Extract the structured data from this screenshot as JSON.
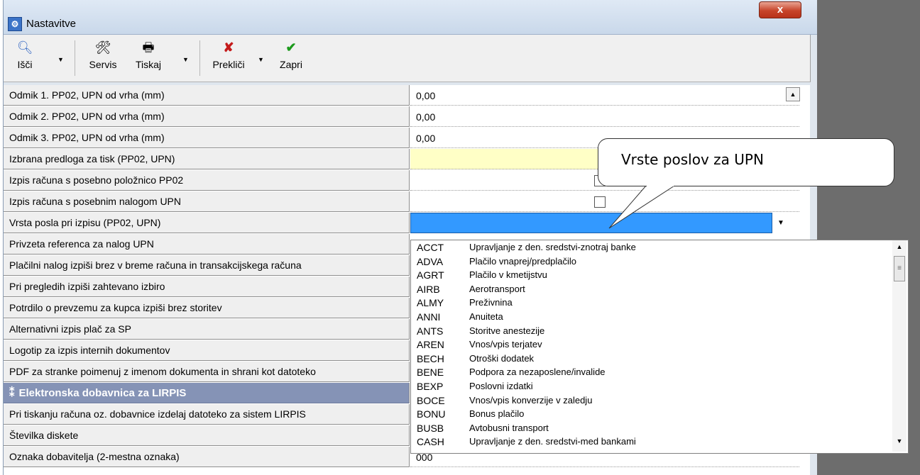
{
  "window": {
    "title": "Nastavitve",
    "close_label": "x"
  },
  "toolbar": {
    "search_label": "Išči",
    "service_label": "Servis",
    "print_label": "Tiskaj",
    "cancel_label": "Prekliči",
    "close_label": "Zapri"
  },
  "rows": [
    {
      "label": "Odmik 1. PP02, UPN od vrha (mm)",
      "value": "0,00"
    },
    {
      "label": "Odmik 2. PP02, UPN od vrha (mm)",
      "value": "0,00"
    },
    {
      "label": "Odmik 3. PP02, UPN od vrha (mm)",
      "value": "0,00"
    },
    {
      "label": "Izbrana predloga za tisk (PP02, UPN)",
      "value": ""
    },
    {
      "label": "Izpis računa s posebno položnico PP02",
      "value": ""
    },
    {
      "label": "Izpis računa s posebnim nalogom UPN",
      "value": ""
    },
    {
      "label": "Vrsta posla pri izpisu (PP02, UPN)",
      "value": ""
    },
    {
      "label": "Privzeta referenca za nalog UPN",
      "value": ""
    },
    {
      "label": "Plačilni nalog izpiši brez v breme računa in transakcijskega računa",
      "value": ""
    },
    {
      "label": "Pri pregledih izpiši zahtevano izbiro",
      "value": ""
    },
    {
      "label": "Potrdilo o prevzemu za kupca izpiši brez storitev",
      "value": ""
    },
    {
      "label": "Alternativni izpis plač za SP",
      "value": ""
    },
    {
      "label": "Logotip za izpis internih dokumentov",
      "value": ""
    },
    {
      "label": "PDF za stranke poimenuj z imenom dokumenta in shrani kot datoteko",
      "value": ""
    },
    {
      "label": "Elektronska dobavnica za LIRPIS",
      "value": ""
    },
    {
      "label": "Pri tiskanju računa oz. dobavnice izdelaj datoteko za sistem LIRPIS",
      "value": ""
    },
    {
      "label": "Številka diskete",
      "value": ""
    },
    {
      "label": "Oznaka dobavitelja (2-mestna oznaka)",
      "value": "000"
    }
  ],
  "section_icon": "⁑",
  "dropdown": {
    "options": [
      {
        "code": "ACCT",
        "desc": "Upravljanje z den. sredstvi-znotraj banke"
      },
      {
        "code": "ADVA",
        "desc": "Plačilo vnaprej/predplačilo"
      },
      {
        "code": "AGRT",
        "desc": "Plačilo v kmetijstvu"
      },
      {
        "code": "AIRB",
        "desc": "Aerotransport"
      },
      {
        "code": "ALMY",
        "desc": "Preživnina"
      },
      {
        "code": "ANNI",
        "desc": "Anuiteta"
      },
      {
        "code": "ANTS",
        "desc": "Storitve anestezije"
      },
      {
        "code": "AREN",
        "desc": "Vnos/vpis terjatev"
      },
      {
        "code": "BECH",
        "desc": "Otroški dodatek"
      },
      {
        "code": "BENE",
        "desc": "Podpora za nezaposlene/invalide"
      },
      {
        "code": "BEXP",
        "desc": "Poslovni izdatki"
      },
      {
        "code": "BOCE",
        "desc": "Vnos/vpis konverzije v zaledju"
      },
      {
        "code": "BONU",
        "desc": "Bonus plačilo"
      },
      {
        "code": "BUSB",
        "desc": "Avtobusni transport"
      },
      {
        "code": "CASH",
        "desc": "Upravljanje z den. sredstvi-med bankami"
      }
    ]
  },
  "callout": {
    "text": "Vrste poslov za UPN"
  }
}
